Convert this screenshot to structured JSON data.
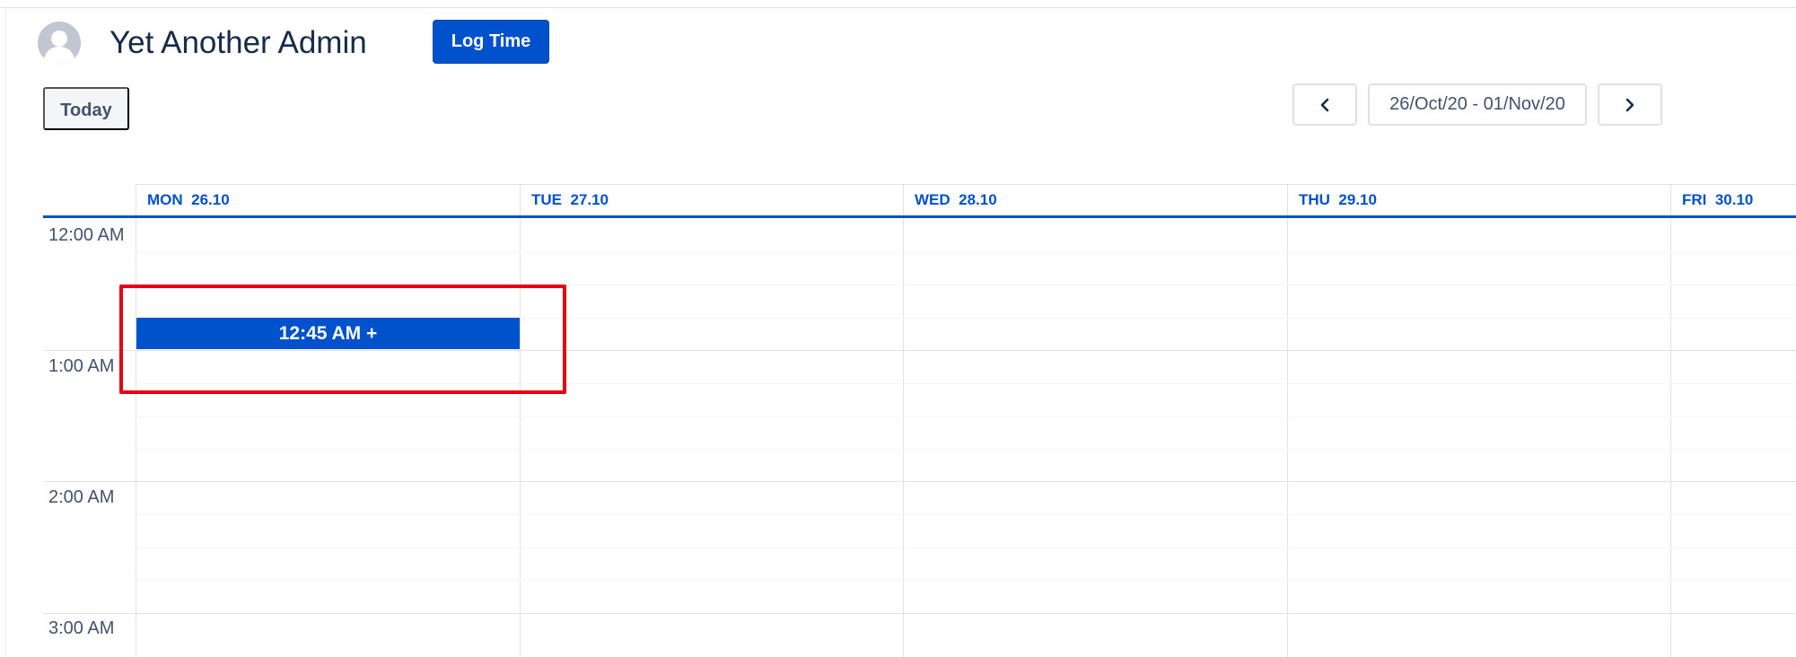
{
  "header": {
    "user_name": "Yet Another Admin",
    "log_time_label": "Log Time"
  },
  "toolbar": {
    "today_label": "Today",
    "date_range": "26/Oct/20 - 01/Nov/20"
  },
  "calendar": {
    "days": [
      {
        "name": "MON",
        "date": "26.10"
      },
      {
        "name": "TUE",
        "date": "27.10"
      },
      {
        "name": "WED",
        "date": "28.10"
      },
      {
        "name": "THU",
        "date": "29.10"
      },
      {
        "name": "FRI",
        "date": "30.10"
      }
    ],
    "time_labels": [
      "12:00 AM",
      "1:00 AM",
      "2:00 AM",
      "3:00 AM"
    ],
    "event": {
      "label": "12:45 AM +"
    }
  },
  "colors": {
    "accent": "#0052cc",
    "highlight": "#e60012",
    "border": "#dfe1e6",
    "text_muted": "#42526e"
  },
  "icons": {
    "avatar": "user-avatar-icon",
    "prev": "chevron-left-icon",
    "next": "chevron-right-icon"
  }
}
